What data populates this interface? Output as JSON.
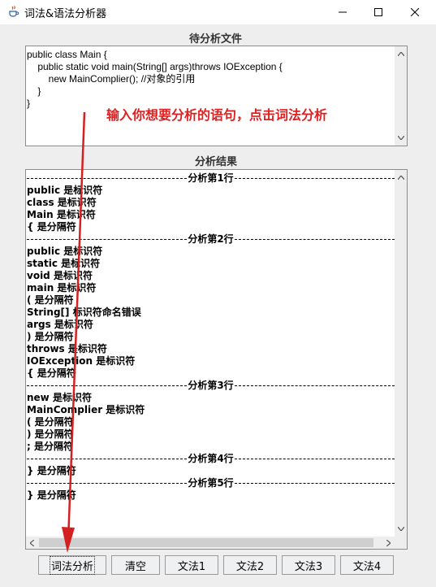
{
  "window": {
    "title": "词法&语法分析器",
    "icon": "java-cup-icon",
    "controls": [
      "minimize-icon",
      "maximize-icon",
      "close-icon"
    ]
  },
  "source_section": {
    "label": "待分析文件",
    "code_lines": [
      "public class Main {",
      "    public static void main(String[] args)throws IOException {",
      "        new MainComplier(); //对象的引用",
      "    }",
      "}"
    ]
  },
  "annotation": {
    "text": "输入你想要分析的语句，点击词法分析",
    "color": "#e02020"
  },
  "result_section": {
    "label": "分析结果",
    "lines": [
      {
        "sep": true,
        "text": "分析第1行"
      },
      {
        "sep": false,
        "text": "public 是标识符"
      },
      {
        "sep": false,
        "text": "class 是标识符"
      },
      {
        "sep": false,
        "text": "Main 是标识符"
      },
      {
        "sep": false,
        "text": "{ 是分隔符"
      },
      {
        "sep": true,
        "text": "分析第2行"
      },
      {
        "sep": false,
        "text": "public 是标识符"
      },
      {
        "sep": false,
        "text": "static 是标识符"
      },
      {
        "sep": false,
        "text": "void 是标识符"
      },
      {
        "sep": false,
        "text": "main 是标识符"
      },
      {
        "sep": false,
        "text": "( 是分隔符"
      },
      {
        "sep": false,
        "text": "String[] 标识符命名错误"
      },
      {
        "sep": false,
        "text": "args 是标识符"
      },
      {
        "sep": false,
        "text": ") 是分隔符"
      },
      {
        "sep": false,
        "text": "throws 是标识符"
      },
      {
        "sep": false,
        "text": "IOException 是标识符"
      },
      {
        "sep": false,
        "text": "{ 是分隔符"
      },
      {
        "sep": true,
        "text": "分析第3行"
      },
      {
        "sep": false,
        "text": "new 是标识符"
      },
      {
        "sep": false,
        "text": "MainComplier 是标识符"
      },
      {
        "sep": false,
        "text": "( 是分隔符"
      },
      {
        "sep": false,
        "text": ") 是分隔符"
      },
      {
        "sep": false,
        "text": "; 是分隔符"
      },
      {
        "sep": true,
        "text": "分析第4行"
      },
      {
        "sep": false,
        "text": "} 是分隔符"
      },
      {
        "sep": true,
        "text": "分析第5行"
      },
      {
        "sep": false,
        "text": "} 是分隔符"
      }
    ]
  },
  "buttons": {
    "lexical": "词法分析",
    "clear": "清空",
    "grammar1": "文法1",
    "grammar2": "文法2",
    "grammar3": "文法3",
    "grammar4": "文法4"
  },
  "colors": {
    "window_bg": "#eeeeee",
    "pane_bg": "#ffffff",
    "annotation_red": "#e02020",
    "button_bg": "#eef0f2"
  }
}
